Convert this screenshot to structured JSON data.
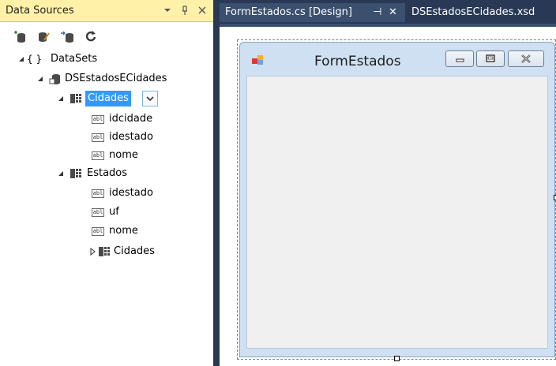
{
  "data_sources": {
    "title": "Data Sources",
    "header_buttons": [
      "dropdown-icon",
      "pin-icon",
      "close-icon"
    ],
    "toolbar": [
      "add-data-source-icon",
      "edit-dataset-designer-icon",
      "configure-dataset-icon",
      "refresh-icon"
    ],
    "tree": {
      "root": "DataSets",
      "dataset": "DSEstadosECidades",
      "cidades": {
        "label": "Cidades",
        "fields": [
          "idcidade",
          "idestado",
          "nome"
        ]
      },
      "estados": {
        "label": "Estados",
        "fields": [
          "idestado",
          "uf",
          "nome"
        ],
        "child_table": "Cidades"
      },
      "field_icon_text": "abl",
      "root_glyph": "{ }"
    }
  },
  "tabs": [
    {
      "label": "FormEstados.cs [Design]",
      "active": true,
      "pin": "⊣",
      "close": "✕"
    },
    {
      "label": "DSEstadosECidades.xsd",
      "active": false
    }
  ],
  "designer": {
    "form_title": "FormEstados"
  },
  "colors": {
    "ide_background": "#293955",
    "panel_header": "#fff1a8",
    "selection": "#3399ff",
    "form_caption": "#cfe0f2"
  }
}
